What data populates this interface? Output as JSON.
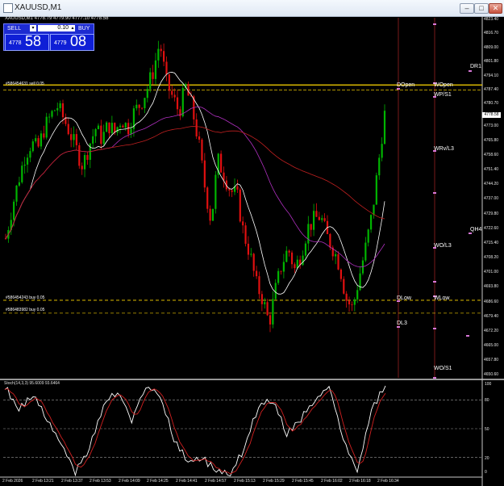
{
  "window": {
    "title": "XAUUSD,M1"
  },
  "symbol_line": "XAUUSD,M1  4778.79 4779.90 4777.10 4778.58",
  "trade_panel": {
    "sell_label": "SELL",
    "buy_label": "BUY",
    "lot": "0.10",
    "sell_price_small": "4778",
    "sell_price_big": "58",
    "buy_price_small": "4779",
    "buy_price_big": "08"
  },
  "levels": [
    "DOpen",
    "WOpen",
    "WP/S1",
    "WRv/L3",
    "WO/L3",
    "DLow",
    "WLow",
    "DL3",
    "WO/S1",
    "DR1",
    "QH4"
  ],
  "order_labels": [
    "#586454631 sell 0.05",
    "#586454243 buy 0.05",
    "#586483982 buy 0.05"
  ],
  "current_price": "4778.58",
  "price_axis": [
    "4823.40",
    "4816.70",
    "4809.00",
    "4801.80",
    "4794.10",
    "4787.40",
    "4780.70",
    "4773.00",
    "4765.80",
    "4758.60",
    "4751.40",
    "4744.20",
    "4737.00",
    "4729.80",
    "4722.60",
    "4715.40",
    "4708.20",
    "4701.00",
    "4693.80",
    "4686.60",
    "4679.40",
    "4672.20",
    "4665.00",
    "4657.80",
    "4650.60"
  ],
  "stoch_axis": [
    "100",
    "80",
    "50",
    "20",
    "0"
  ],
  "stoch_info": "Stoch(14,3,3) 95.6009 93.6464",
  "time_axis": [
    "2 Feb 2026",
    "2 Feb 13:21",
    "2 Feb 13:37",
    "2 Feb 13:53",
    "2 Feb 14:09",
    "2 Feb 14:25",
    "2 Feb 14:41",
    "2 Feb 14:57",
    "2 Feb 15:13",
    "2 Feb 15:29",
    "2 Feb 15:45",
    "2 Feb 16:02",
    "2 Feb 16:18",
    "2 Feb 16:34"
  ],
  "colors": {
    "background": "#000000",
    "bull": "#00b400",
    "bear": "#e01010",
    "ma_fast": "#ffffff",
    "ma_mid": "#b030c0",
    "ma_slow": "#c02020",
    "stoch_main": "#ffffff",
    "stoch_signal": "#d02020",
    "sell_line": "#ffd800",
    "buy_line": "#ffd800",
    "panel": "#1d2bd0"
  },
  "chart_data": {
    "type": "candlestick",
    "symbol": "XAUUSD",
    "timeframe": "M1",
    "last": {
      "open": 4778.79,
      "high": 4779.9,
      "low": 4777.1,
      "close": 4778.58
    },
    "ylim": [
      4650.6,
      4823.4
    ],
    "closes_approx": [
      4717,
      4732,
      4745,
      4757,
      4763,
      4760,
      4770,
      4776,
      4781,
      4775,
      4768,
      4760,
      4752,
      4762,
      4770,
      4765,
      4772,
      4768,
      4775,
      4770,
      4778,
      4782,
      4789,
      4798,
      4812,
      4792,
      4785,
      4778,
      4790,
      4780,
      4764,
      4742,
      4725,
      4755,
      4748,
      4740,
      4738,
      4720,
      4710,
      4695,
      4688,
      4676,
      4692,
      4705,
      4712,
      4702,
      4710,
      4722,
      4726,
      4728,
      4718,
      4712,
      4704,
      4688,
      4683,
      4698,
      4712,
      4728,
      4752,
      4778
    ],
    "stochastic": {
      "k": [
        95,
        70,
        85,
        60,
        35,
        5,
        30,
        75,
        90,
        60,
        95,
        85,
        40,
        15,
        20,
        5,
        2,
        30,
        75,
        80,
        45,
        60,
        80,
        95,
        40,
        5,
        70,
        95
      ],
      "d_last": 93.6464,
      "k_last": 95.6009
    }
  }
}
